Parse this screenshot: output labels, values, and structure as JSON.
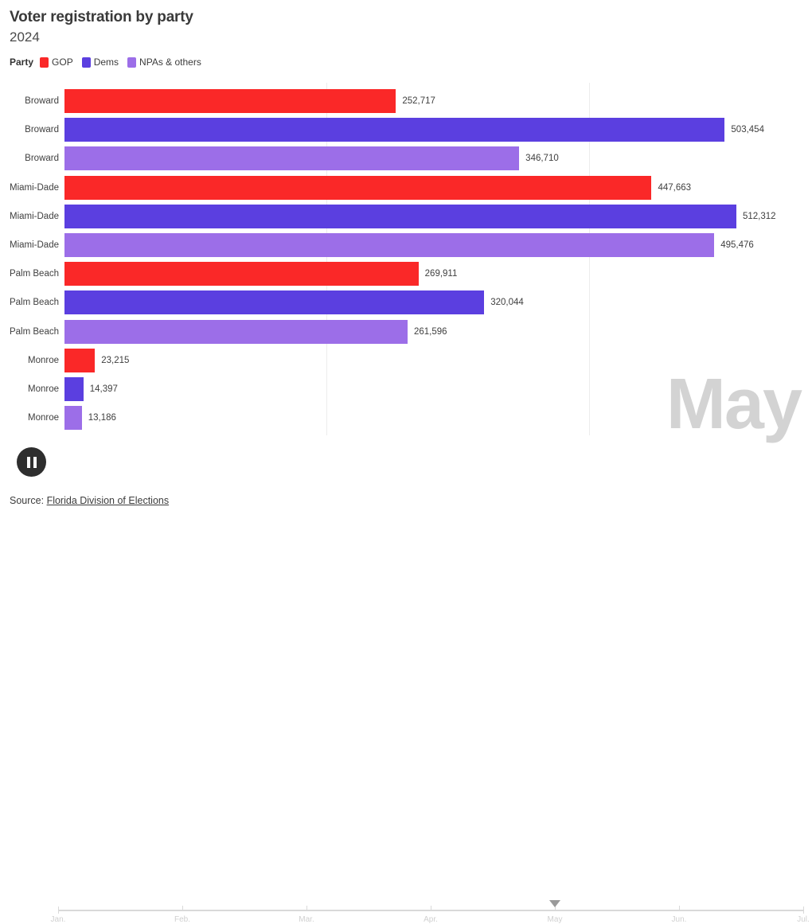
{
  "header": {
    "title": "Voter registration by party",
    "subtitle": "2024"
  },
  "legend": {
    "title": "Party",
    "items": [
      {
        "label": "GOP",
        "color": "#fa2828"
      },
      {
        "label": "Dems",
        "color": "#5b3fe0"
      },
      {
        "label": "NPAs & others",
        "color": "#9c6ee8"
      }
    ]
  },
  "watermark": "May",
  "timeline": {
    "state": "paused",
    "play_button_icon": "pause-icon",
    "current": "May",
    "ticks": [
      "Jan.",
      "Feb.",
      "Mar.",
      "Apr.",
      "May",
      "Jun.",
      "Jul."
    ]
  },
  "source": {
    "prefix": "Source: ",
    "link_text": "Florida Division of Elections"
  },
  "chart_data": {
    "type": "bar",
    "orientation": "horizontal",
    "title": "Voter registration by party",
    "subtitle": "2024",
    "xlabel": "",
    "ylabel": "",
    "xlim": [
      0,
      570000
    ],
    "gridlines": [
      200000,
      400000
    ],
    "grid": true,
    "legend_position": "top-left",
    "value_format": "thousands-comma",
    "categories": [
      "Broward",
      "Miami-Dade",
      "Palm Beach",
      "Monroe"
    ],
    "series": [
      {
        "name": "GOP",
        "color": "#fa2828",
        "values": [
          252717,
          447663,
          269911,
          23215
        ]
      },
      {
        "name": "Dems",
        "color": "#5b3fe0",
        "values": [
          503454,
          512312,
          320044,
          14397
        ]
      },
      {
        "name": "NPAs & others",
        "color": "#9c6ee8",
        "values": [
          346710,
          495476,
          261596,
          13186
        ]
      }
    ],
    "bars": [
      {
        "category": "Broward",
        "party": "GOP",
        "value": 252717,
        "value_label": "252,717",
        "color": "#fa2828"
      },
      {
        "category": "Broward",
        "party": "Dems",
        "value": 503454,
        "value_label": "503,454",
        "color": "#5b3fe0"
      },
      {
        "category": "Broward",
        "party": "NPAs & others",
        "value": 346710,
        "value_label": "346,710",
        "color": "#9c6ee8"
      },
      {
        "category": "Miami-Dade",
        "party": "GOP",
        "value": 447663,
        "value_label": "447,663",
        "color": "#fa2828"
      },
      {
        "category": "Miami-Dade",
        "party": "Dems",
        "value": 512312,
        "value_label": "512,312",
        "color": "#5b3fe0"
      },
      {
        "category": "Miami-Dade",
        "party": "NPAs & others",
        "value": 495476,
        "value_label": "495,476",
        "color": "#9c6ee8"
      },
      {
        "category": "Palm Beach",
        "party": "GOP",
        "value": 269911,
        "value_label": "269,911",
        "color": "#fa2828"
      },
      {
        "category": "Palm Beach",
        "party": "Dems",
        "value": 320044,
        "value_label": "320,044",
        "color": "#5b3fe0"
      },
      {
        "category": "Palm Beach",
        "party": "NPAs & others",
        "value": 261596,
        "value_label": "261,596",
        "color": "#9c6ee8"
      },
      {
        "category": "Monroe",
        "party": "GOP",
        "value": 23215,
        "value_label": "23,215",
        "color": "#fa2828"
      },
      {
        "category": "Monroe",
        "party": "Dems",
        "value": 14397,
        "value_label": "14,397",
        "color": "#5b3fe0"
      },
      {
        "category": "Monroe",
        "party": "NPAs & others",
        "value": 13186,
        "value_label": "13,186",
        "color": "#9c6ee8"
      }
    ]
  }
}
